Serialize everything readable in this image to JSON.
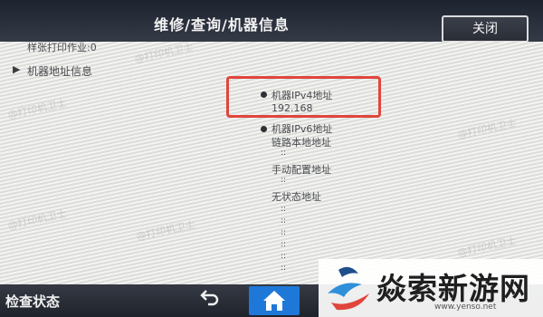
{
  "header": {
    "title": "维修/查询/机器信息",
    "close_label": "关闭"
  },
  "content": {
    "single_print_jobs": "样张打印作业:0",
    "section_label": "机器地址信息",
    "ipv4": {
      "label": "机器IPv4地址",
      "value": "192.168"
    },
    "ipv6": {
      "label": "机器IPv6地址",
      "link_local_label": "链路本地地址",
      "manual_label": "手动配置地址",
      "stateless_label": "无状态地址",
      "dots_symbol": "::"
    },
    "watermark_text": "@打印机卫士"
  },
  "footer": {
    "status_label": "检查状态",
    "back_icon": "back-arrow-icon",
    "home_icon": "home-icon"
  },
  "logo": {
    "text": "焱索新游网",
    "url": "www.yenso.net"
  },
  "colors": {
    "highlight": "#e0463c",
    "home_button": "#1e78d8"
  }
}
